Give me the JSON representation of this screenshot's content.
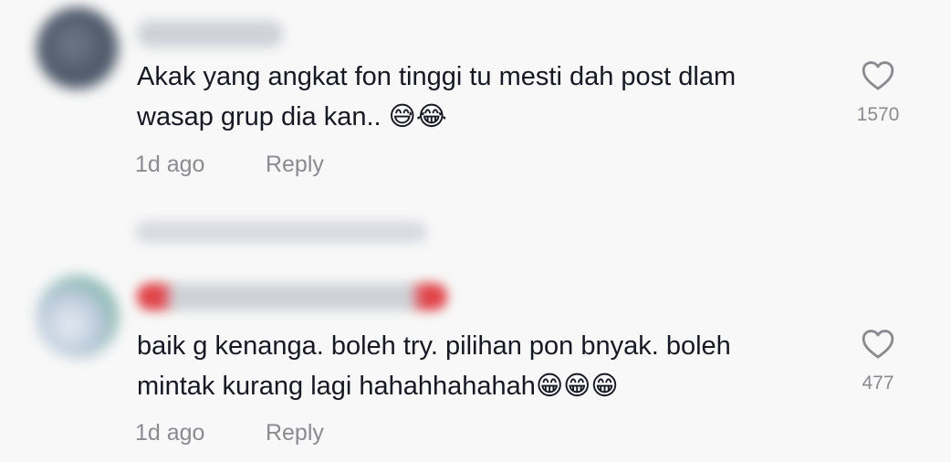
{
  "comments": [
    {
      "text": "Akak yang angkat fon tinggi tu mesti dah post dlam\nwasap grup dia kan.. 😅😂",
      "time": "1d ago",
      "reply_label": "Reply",
      "likes": "1570"
    },
    {
      "text": "baik g kenanga. boleh try. pilihan pon bnyak. boleh\nmintak kurang lagi hahahhahahah😁😁😁",
      "time": "1d ago",
      "reply_label": "Reply",
      "likes": "477"
    }
  ],
  "icons": {
    "like": "heart-outline-icon"
  }
}
